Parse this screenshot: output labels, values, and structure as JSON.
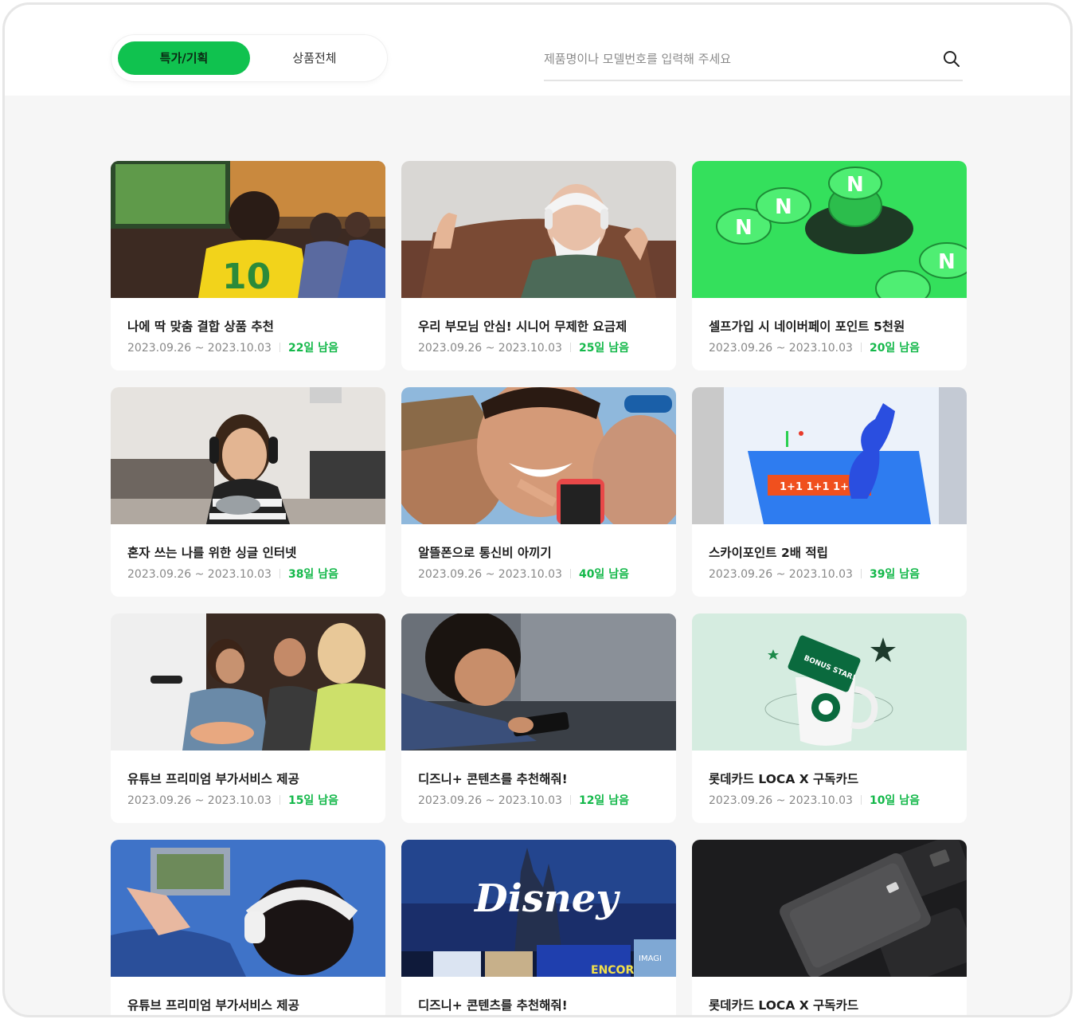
{
  "tabs": [
    {
      "label": "특가/기획",
      "active": true
    },
    {
      "label": "상품전체",
      "active": false
    }
  ],
  "search": {
    "placeholder": "제품명이나 모델번호를 입력해 주세요",
    "value": ""
  },
  "colors": {
    "accent": "#10c24f",
    "accent_text": "#14b84a",
    "background": "#f6f6f6"
  },
  "cards": [
    {
      "title": "나에 딱 맞춤 결합 상품 추천",
      "date": "2023.09.26 ~ 2023.10.03",
      "remaining": "22일 남음"
    },
    {
      "title": "우리 부모님 안심! 시니어 무제한 요금제",
      "date": "2023.09.26 ~ 2023.10.03",
      "remaining": "25일 남음"
    },
    {
      "title": "셀프가입 시 네이버페이 포인트 5천원",
      "date": "2023.09.26 ~ 2023.10.03",
      "remaining": "20일 남음"
    },
    {
      "title": "혼자 쓰는 나를 위한 싱글 인터넷",
      "date": "2023.09.26 ~ 2023.10.03",
      "remaining": "38일 남음"
    },
    {
      "title": "알뜰폰으로 통신비 아끼기",
      "date": "2023.09.26 ~ 2023.10.03",
      "remaining": "40일 남음"
    },
    {
      "title": "스카이포인트 2배 적립",
      "date": "2023.09.26 ~ 2023.10.03",
      "remaining": "39일 남음"
    },
    {
      "title": "유튜브 프리미엄 부가서비스 제공",
      "date": "2023.09.26 ~ 2023.10.03",
      "remaining": "15일 남음"
    },
    {
      "title": "디즈니+ 콘텐츠를 추천해줘!",
      "date": "2023.09.26 ~ 2023.10.03",
      "remaining": "12일 남음"
    },
    {
      "title": "롯데카드 LOCA X 구독카드",
      "date": "2023.09.26 ~ 2023.10.03",
      "remaining": "10일 남음"
    },
    {
      "title": "유튜브 프리미엄 부가서비스 제공",
      "date": "",
      "remaining": ""
    },
    {
      "title": "디즈니+ 콘텐츠를 추천해줘!",
      "date": "",
      "remaining": ""
    },
    {
      "title": "롯데카드 LOCA X 구독카드",
      "date": "",
      "remaining": ""
    }
  ],
  "images": {
    "card9_text": "1+1  1+1  1+",
    "card10_text": "BONUS STAR!",
    "card12_text": "Disney",
    "card12_banner": "ENCORE!",
    "card12_banner2": "IMAGI"
  }
}
